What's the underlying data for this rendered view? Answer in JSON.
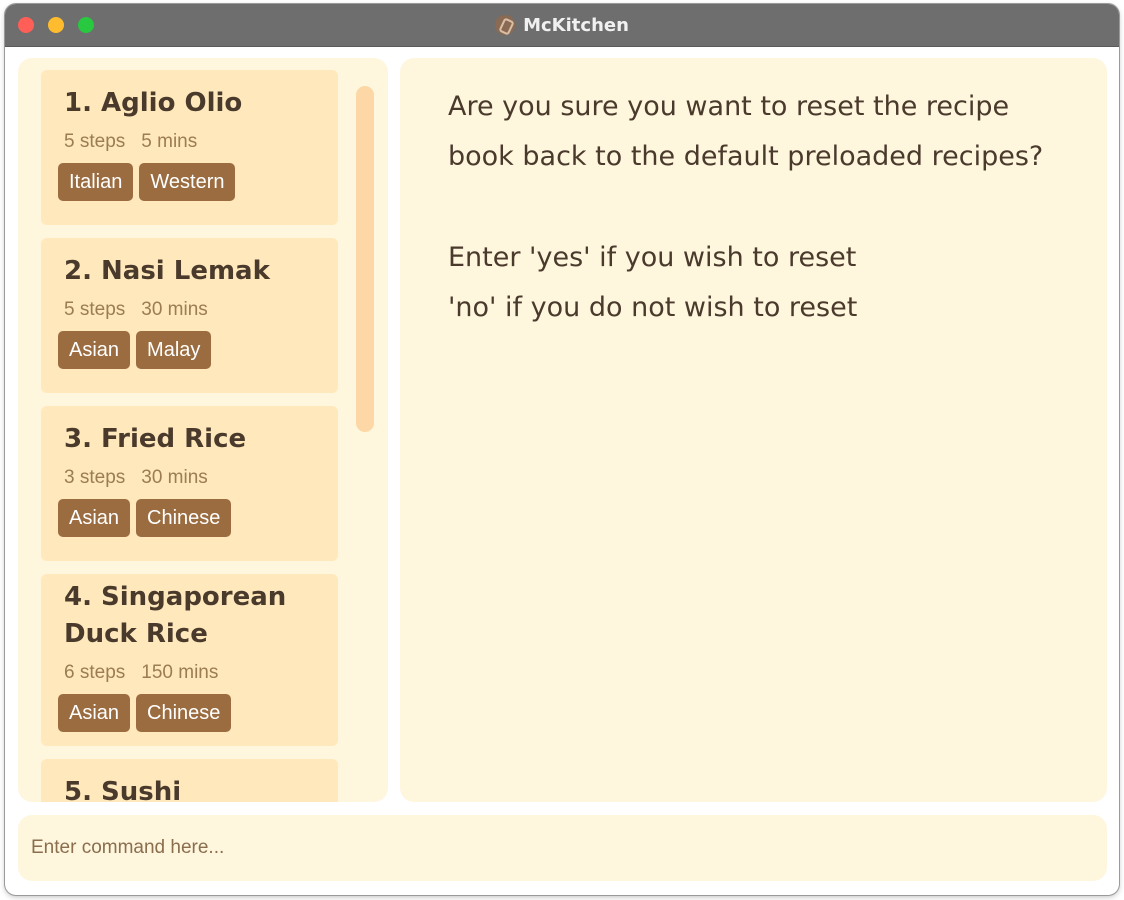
{
  "window": {
    "title": "McKitchen",
    "app_icon": "mckitchen-logo-icon"
  },
  "recipes": [
    {
      "title": "1. Aglio Olio",
      "title_lines": [
        "1. Aglio Olio"
      ],
      "steps": "5 steps",
      "time": "5 mins",
      "tags": [
        "Italian",
        "Western"
      ]
    },
    {
      "title": "2. Nasi Lemak",
      "title_lines": [
        "2. Nasi Lemak"
      ],
      "steps": "5 steps",
      "time": "30 mins",
      "tags": [
        "Asian",
        "Malay"
      ]
    },
    {
      "title": "3. Fried Rice",
      "title_lines": [
        "3. Fried Rice"
      ],
      "steps": "3 steps",
      "time": "30 mins",
      "tags": [
        "Asian",
        "Chinese"
      ]
    },
    {
      "title": "4. Singaporean Duck Rice",
      "title_lines": [
        "4. Singaporean",
        "Duck Rice"
      ],
      "steps": "6 steps",
      "time": "150 mins",
      "tags": [
        "Asian",
        "Chinese"
      ]
    },
    {
      "title": "5. Sushi",
      "title_lines": [
        "5. Sushi"
      ],
      "steps": "",
      "time": "",
      "tags": []
    }
  ],
  "message": {
    "lines": [
      "Are you sure you want to reset the recipe",
      "book back to the default preloaded recipes?",
      "",
      "Enter 'yes' if you wish to reset",
      "'no' if you do not wish to reset"
    ]
  },
  "command": {
    "placeholder": "Enter command here...",
    "value": ""
  },
  "colors": {
    "panel_bg": "#fef6dd",
    "card_bg": "#ffe8bc",
    "tag_bg": "#9b6c40",
    "text_dark": "#4a3a2c",
    "text_meta": "#9c7c52",
    "scrollbar": "#fdd8a6",
    "titlebar": "#6e6e6e"
  }
}
